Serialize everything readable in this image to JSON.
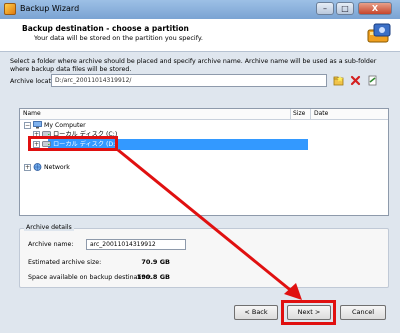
{
  "window": {
    "title": "Backup Wizard",
    "min": "–",
    "max": "□",
    "close": "X"
  },
  "header": {
    "title": "Backup destination - choose a partition",
    "subtitle": "Your data will be stored on the partition you specify."
  },
  "description": "Select a folder where archive should be placed and specify archive name. Archive name will be used as a sub-folder where backup data files will be stored.",
  "location": {
    "label": "Archive location:",
    "value": "D:/arc_20011014319912/"
  },
  "tree": {
    "columns": {
      "name": "Name",
      "size": "Size",
      "date": "Date"
    },
    "items": [
      {
        "label": "My Computer"
      },
      {
        "label": "ローカル ディスク (C:)"
      },
      {
        "label": "ローカル ディスク (D:)"
      },
      {
        "label": "Network"
      }
    ]
  },
  "details": {
    "legend": "Archive details",
    "name_label": "Archive name:",
    "name_value": "arc_20011014319912",
    "est_label": "Estimated archive size:",
    "est_value": "70.9 GB",
    "space_label": "Space available on backup destination:",
    "space_value": "190.8 GB"
  },
  "buttons": {
    "back": "< Back",
    "next": "Next >",
    "cancel": "Cancel"
  },
  "colors": {
    "annotation": "#e01010",
    "selection": "#3399ff"
  }
}
